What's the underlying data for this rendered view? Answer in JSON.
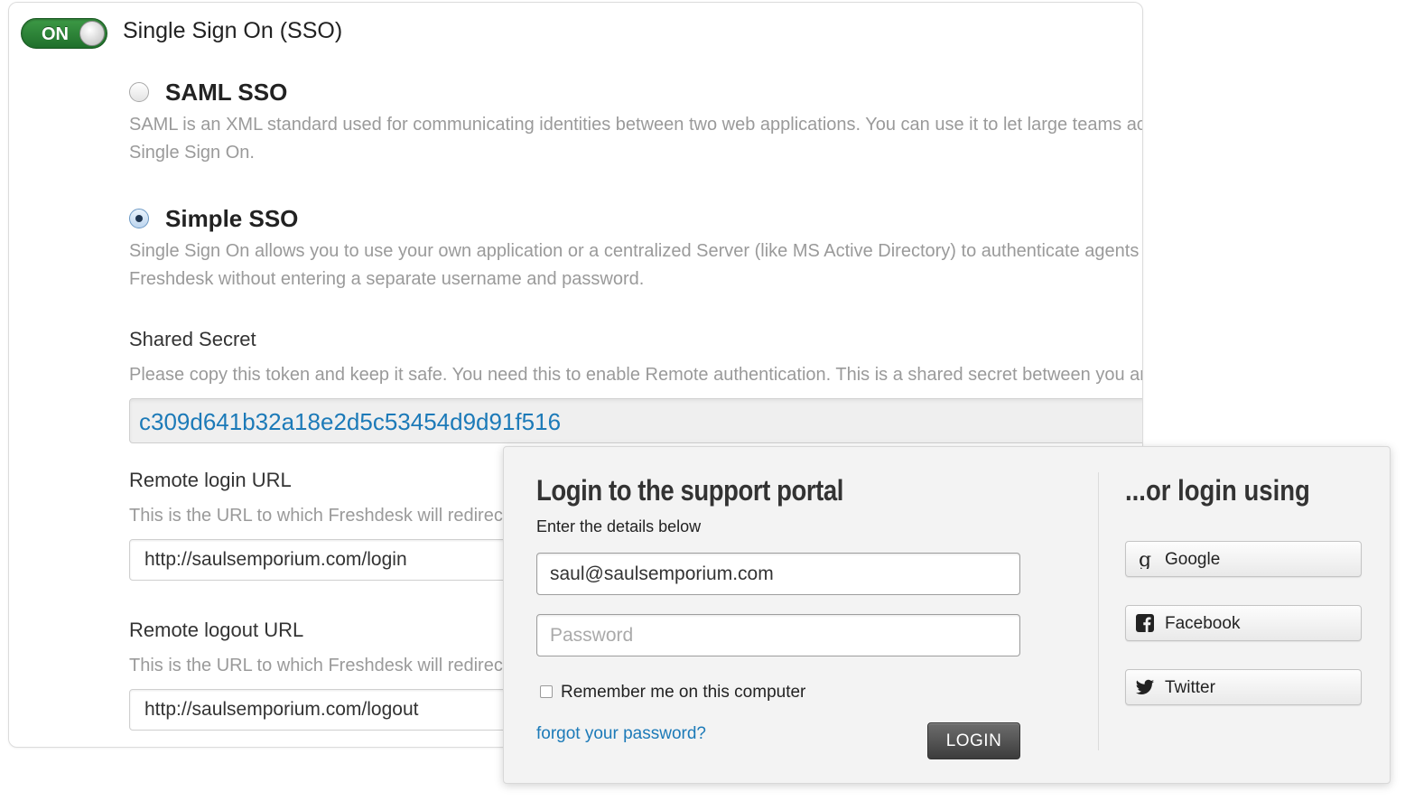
{
  "sso": {
    "toggle_label": "ON",
    "title": "Single Sign On (SSO)",
    "options": [
      {
        "title": "SAML SSO",
        "selected": false,
        "description": "SAML is an XML standard used for communicating identities between two web applications. You can use it to let large teams ac Single Sign On."
      },
      {
        "title": "Simple SSO",
        "selected": true,
        "description": "Single Sign On allows you to use your own application or a centralized Server (like MS Active Directory) to authenticate agents a Freshdesk without entering a separate username and password."
      }
    ],
    "shared_secret": {
      "label": "Shared Secret",
      "help": "Please copy this token and keep it safe. You need this to enable Remote authentication. This is a shared secret between you and",
      "value": "c309d641b32a18e2d5c53454d9d91f516"
    },
    "remote_login": {
      "label": "Remote login URL",
      "help": "This is the URL to which Freshdesk will redirect",
      "value": "http://saulsemporium.com/login"
    },
    "remote_logout": {
      "label": "Remote logout URL",
      "help": "This is the URL to which Freshdesk will redirect",
      "value": "http://saulsemporium.com/logout"
    }
  },
  "login": {
    "heading": "Login to the support portal",
    "subheading": "Enter the details below",
    "email_value": "saul@saulsemporium.com",
    "password_placeholder": "Password",
    "remember_label": "Remember me on this computer",
    "forgot_link": "forgot your password?",
    "login_button": "LOGIN",
    "alt_heading": "...or login using",
    "social": [
      {
        "label": "Google",
        "icon": "google-icon"
      },
      {
        "label": "Facebook",
        "icon": "facebook-icon"
      },
      {
        "label": "Twitter",
        "icon": "twitter-icon"
      }
    ]
  },
  "colors": {
    "toggle_on": "#2e8a3a",
    "link": "#1c7ab8",
    "login_button": "#4a4a4a"
  }
}
